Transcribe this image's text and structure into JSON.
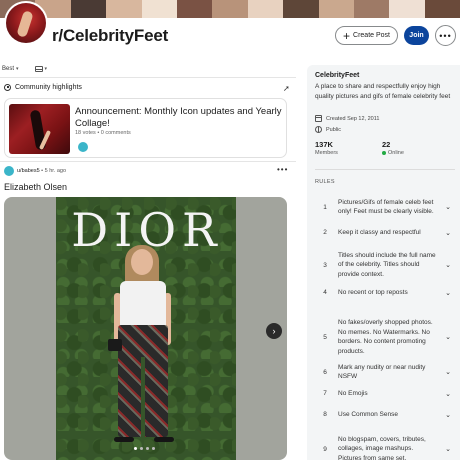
{
  "banner": {
    "tiles": [
      "#8a6a5a",
      "#c9a48a",
      "#4a3a34",
      "#d8b79e",
      "#f0e1d2",
      "#7a5244",
      "#b8937a",
      "#e8d2c0",
      "#5e4638",
      "#caa88e",
      "#9e7a66",
      "#efe0d4",
      "#6a4a3a"
    ]
  },
  "header": {
    "subreddit": "r/CelebrityFeet",
    "create_post_label": "Create Post",
    "join_label": "Join",
    "more_label": "•••"
  },
  "sortbar": {
    "sort_value": "Best"
  },
  "highlights": {
    "heading": "Community highlights",
    "card": {
      "title": "Announcement: Monthly Icon updates and Yearly Collage!",
      "meta": "18 votes • 0 comments"
    }
  },
  "post": {
    "user": "u/babes5",
    "age": "• 5 hr. ago",
    "title": "Elizabeth Olsen",
    "image_text": "DIOR",
    "next_label": "›"
  },
  "sidebar": {
    "name": "CelebrityFeet",
    "description": "A place to share and respectfully enjoy high quality pictures and gifs of female celebrity feet",
    "created": "Created Sep 12, 2011",
    "visibility": "Public",
    "members_count": "137K",
    "members_label": "Members",
    "online_count": "22",
    "online_label": "Online",
    "rules_heading": "RULES",
    "rules": [
      {
        "num": "1",
        "text": "Pictures/Gifs of female celeb feet only! Feet must be clearly visible."
      },
      {
        "num": "2",
        "text": "Keep it classy and respectful"
      },
      {
        "num": "3",
        "text": "Titles should include the full name of the celebrity. Titles should provide context."
      },
      {
        "num": "4",
        "text": "No recent or top reposts"
      },
      {
        "num": "5",
        "text": "No fakes/overly shopped photos. No memes. No Watermarks. No borders. No content promoting products."
      },
      {
        "num": "6",
        "text": "Mark any nudity or near nudity NSFW"
      },
      {
        "num": "7",
        "text": "No Emojis"
      },
      {
        "num": "8",
        "text": "Use Common Sense"
      },
      {
        "num": "9",
        "text": "No blogspam, covers, tributes, collages, image mashups. Pictures from same set."
      }
    ]
  },
  "colors": {
    "join": "#0b449c",
    "online": "#22aa44",
    "sidebar_bg": "#f3f5f6"
  }
}
